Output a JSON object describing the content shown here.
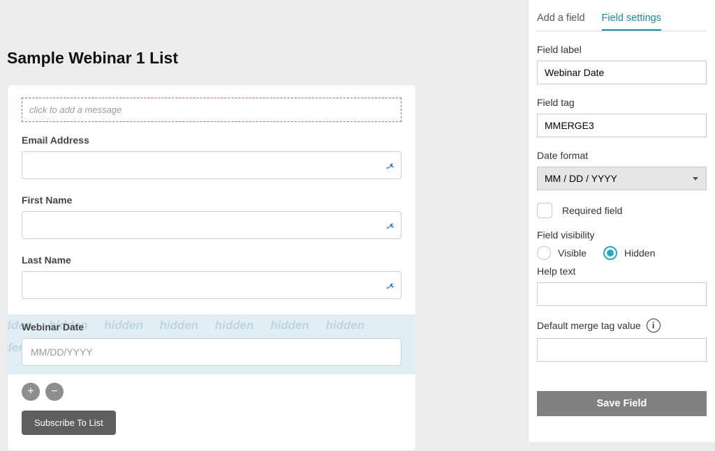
{
  "page": {
    "title": "Sample Webinar 1 List"
  },
  "form": {
    "add_message_placeholder": "click to add a message",
    "fields": {
      "email": {
        "label": "Email Address",
        "value": ""
      },
      "first_name": {
        "label": "First Name",
        "value": ""
      },
      "last_name": {
        "label": "Last Name",
        "value": ""
      },
      "webinar_date": {
        "label": "Webinar Date",
        "placeholder": "MM/DD/YYYY",
        "value": ""
      }
    },
    "subscribe_label": "Subscribe To List"
  },
  "panel": {
    "tabs": {
      "add_field": "Add a field",
      "field_settings": "Field settings"
    },
    "field_label_label": "Field label",
    "field_label_value": "Webinar Date",
    "field_tag_label": "Field tag",
    "field_tag_value": "MMERGE3",
    "date_format_label": "Date format",
    "date_format_value": "MM / DD / YYYY",
    "required_label": "Required field",
    "required_checked": false,
    "visibility_label": "Field visibility",
    "visibility_visible": "Visible",
    "visibility_hidden": "Hidden",
    "visibility_selected": "hidden",
    "help_text_label": "Help text",
    "help_text_value": "",
    "default_merge_label": "Default merge tag value",
    "default_merge_value": "",
    "save_label": "Save Field"
  }
}
